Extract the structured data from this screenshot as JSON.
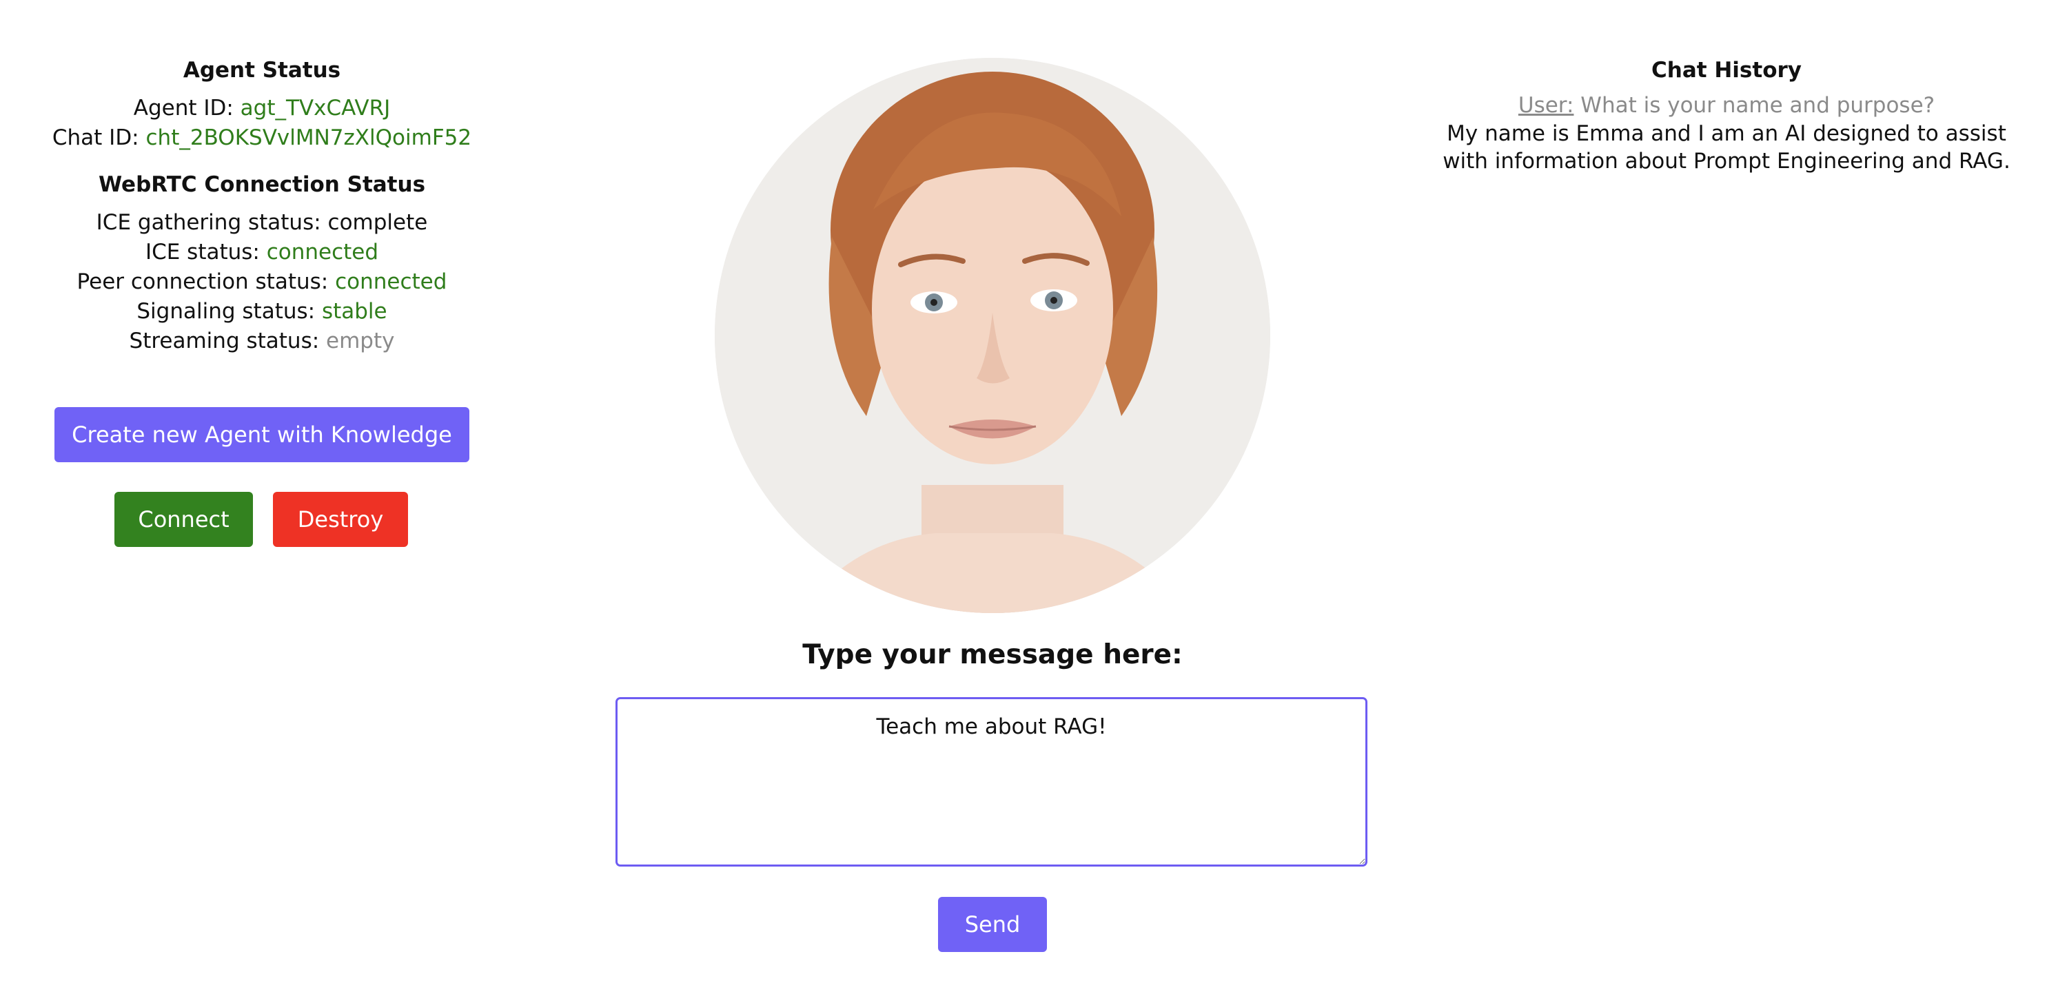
{
  "agent_status": {
    "title": "Agent Status",
    "agent_id_label": "Agent ID:",
    "agent_id": "agt_TVxCAVRJ",
    "chat_id_label": "Chat ID:",
    "chat_id": "cht_2BOKSVvlMN7zXlQoimF52"
  },
  "webrtc": {
    "title": "WebRTC Connection Status",
    "ice_gathering_label": "ICE gathering status:",
    "ice_gathering_value": "complete",
    "ice_label": "ICE status:",
    "ice_value": "connected",
    "peer_label": "Peer connection status:",
    "peer_value": "connected",
    "signaling_label": "Signaling status:",
    "signaling_value": "stable",
    "streaming_label": "Streaming status:",
    "streaming_value": "empty"
  },
  "buttons": {
    "create_agent": "Create new Agent with Knowledge",
    "connect": "Connect",
    "destroy": "Destroy",
    "send": "Send"
  },
  "message": {
    "label": "Type your message here:",
    "value": "Teach me about RAG!"
  },
  "chat_history": {
    "title": "Chat History",
    "messages": [
      {
        "speaker": "User:",
        "text": "What is your name and purpose?"
      },
      {
        "speaker": "",
        "text": "My name is Emma and I am an AI designed to assist with information about Prompt Engineering and RAG."
      }
    ]
  },
  "colors": {
    "status_ok": "#2f7d1b",
    "status_muted": "#8a8a8a",
    "primary": "#7062f6",
    "connect": "#33821f",
    "destroy": "#ee3225"
  }
}
